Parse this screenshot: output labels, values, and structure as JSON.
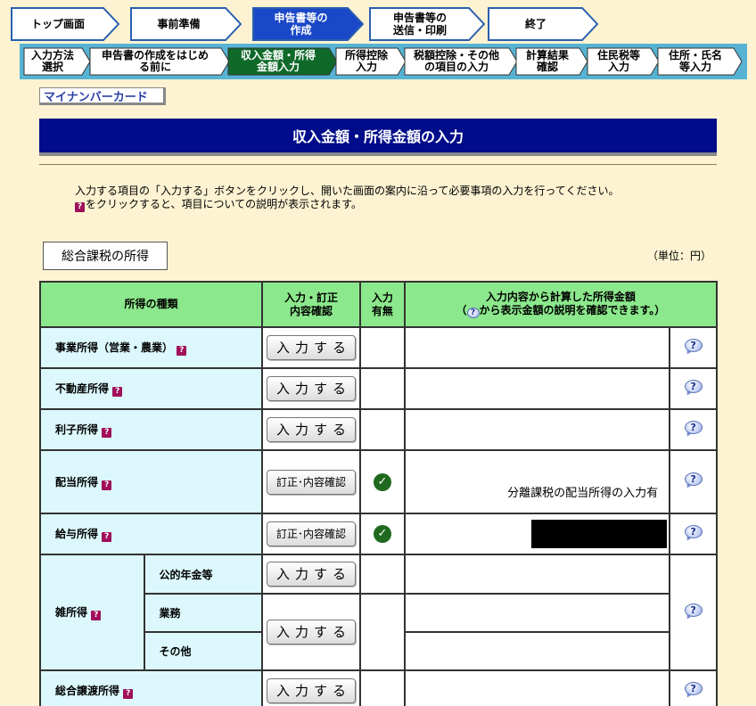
{
  "steps": [
    {
      "label": "トップ画面",
      "active": false
    },
    {
      "label": "事前準備",
      "active": false
    },
    {
      "label": "申告書等の\n作成",
      "active": true
    },
    {
      "label": "申告書等の\n送信・印刷",
      "active": false
    },
    {
      "label": "終了",
      "active": false
    }
  ],
  "substeps": [
    {
      "label": "入力方法\n選択",
      "active": false
    },
    {
      "label": "申告書の作成をはじめ\nる前に",
      "active": false
    },
    {
      "label": "収入金額・所得\n金額入力",
      "active": true
    },
    {
      "label": "所得控除\n入力",
      "active": false
    },
    {
      "label": "税額控除・その他\nの項目の入力",
      "active": false
    },
    {
      "label": "計算結果\n確認",
      "active": false
    },
    {
      "label": "住民税等\n入力",
      "active": false
    },
    {
      "label": "住所・氏名\n等入力",
      "active": false
    }
  ],
  "mynumber_label": "マイナンバーカード",
  "page_title": "収入金額・所得金額の入力",
  "instructions": {
    "line1": "入力する項目の「入力する」ボタンをクリックし、開いた画面の案内に沿って必要事項の入力を行ってください。",
    "line2_badge": "?",
    "line2": "をクリックすると、項目についての説明が表示されます。"
  },
  "section_label": "総合課税の所得",
  "unit": "（単位：円）",
  "table": {
    "headers": {
      "kind": "所得の種類",
      "action": "入力・訂正\n内容確認",
      "status": "入力\n有無",
      "amount_line1": "入力内容から計算した所得金額",
      "amount_line2_pre": "（",
      "amount_line2_post": "から表示金額の説明を確認できます。）"
    },
    "input_label": "入力する",
    "edit_label": "訂正･内容確認",
    "help_glyph": "?",
    "check_glyph": "✓",
    "rows": {
      "business": "事業所得（営業・農業）",
      "real_estate": "不動産所得",
      "interest": "利子所得",
      "dividend": "配当所得",
      "dividend_amount": "分離課税の配当所得の入力有",
      "salary": "給与所得",
      "misc": "雑所得",
      "misc_pension": "公的年金等",
      "misc_business": "業務",
      "misc_other": "その他",
      "capital_gains": "総合譲渡所得"
    }
  }
}
